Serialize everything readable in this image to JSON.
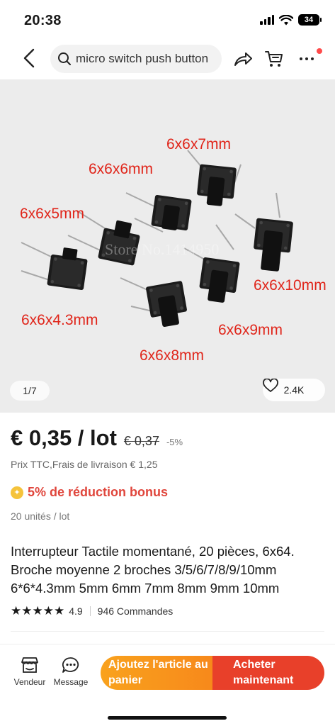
{
  "status": {
    "time": "20:38",
    "battery": "34"
  },
  "search": {
    "query": "micro switch push button"
  },
  "gallery": {
    "labels": [
      "6x6x7mm",
      "6x6x6mm",
      "6x6x5mm",
      "6x6x4.3mm",
      "6x6x10mm",
      "6x6x9mm",
      "6x6x8mm"
    ],
    "watermark": "Store No.1414950",
    "pager": "1/7",
    "likes": "2.4K"
  },
  "price": {
    "current": "€ 0,35 / lot",
    "old": "€ 0,37",
    "discount": "-5%"
  },
  "shipping": "Prix TTC,Frais de livraison € 1,25",
  "bonus": "5% de réduction bonus",
  "units": "20 unités / lot",
  "product_title": "Interrupteur Tactile momentané, 20 pièces, 6x64. Broche moyenne 2 broches 3/5/6/7/8/9/10mm 6*6*4.3mm 5mm 6mm 7mm 8mm 9mm 10mm",
  "rating": {
    "stars": "★★★★★",
    "score": "4.9",
    "orders": "946 Commandes"
  },
  "bottom_bar": {
    "seller": "Vendeur",
    "message": "Message",
    "add_to_cart": "Ajoutez l'article au panier",
    "buy_now": "Acheter maintenant"
  },
  "colors": {
    "accent_red": "#e8402a",
    "accent_orange": "#f7891b",
    "label_red": "#e0261b"
  }
}
